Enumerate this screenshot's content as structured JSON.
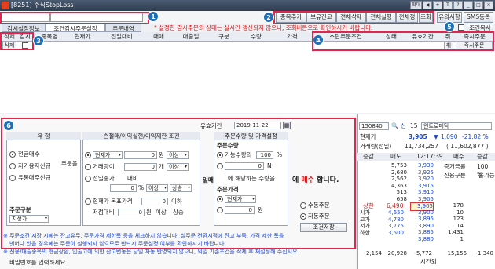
{
  "title": "[8251] 주식StopLoss",
  "window_buttons": [
    "확대",
    "◀",
    "+",
    "T",
    "?",
    "_",
    "□",
    "×"
  ],
  "toolbar": {
    "account_value": "",
    "account_name": "",
    "buttons": [
      "종목추가",
      "보유잔고",
      "전체삭제",
      "전체실행",
      "전체정지",
      "조회"
    ],
    "notice_button": "유의사항",
    "sms_button": "SMS등록",
    "condition_copy": "조건복사"
  },
  "badges": [
    "1",
    "2",
    "3",
    "4",
    "5",
    "6"
  ],
  "tabs": [
    "감시설정정보",
    "조건감시주문설정",
    "주문내역"
  ],
  "notice": "* 설정한 감시주문의 상태는 실시간 갱신되지 않으니, 조회버튼으로 확인하시기 바랍니다.",
  "grid": {
    "headers": [
      "삭제",
      "감시",
      "종목명",
      "현재가",
      "전일대비",
      "매매",
      "대출일",
      "구분",
      "수량",
      "가격",
      "스탑주문조건",
      "상태",
      "유효기간",
      "취",
      "즉시주문"
    ],
    "row": {
      "delete": "삭제",
      "cancel": "취",
      "order": "즉시주문"
    }
  },
  "form": {
    "valid_label": "유효기간",
    "valid_date": "2019-11-22",
    "section_type": "유    형",
    "types": [
      "현금매수",
      "자기융자신규",
      "유통대주신규"
    ],
    "order_type_label": "주문구분",
    "order_type": "지정가",
    "order_word": "주문을",
    "section_cond": "손절매/이익실현/이익제한 조건",
    "cond_price_label": "현재가",
    "cond_unit": "원",
    "cond_op": "이상",
    "cond_value": "0",
    "trade_qty_label": "거래량이",
    "trade_unit": "개",
    "trade_value": "0",
    "trade_op": "이상",
    "prevday_label": "전일종가",
    "prevday_op": "대비",
    "prevday_pct": "%",
    "prevday_rise": "상승",
    "prevday_value": "0",
    "target_label": "현재가 목표가격",
    "target_value": "0",
    "target_op": "이하",
    "low_label": "저점대비",
    "low_unit": "원",
    "low_op": "이상",
    "low_rise": "상승",
    "section_qty": "주문수량 및 가격설정",
    "qty_label": "주문수량",
    "qty_option": "가능수량의",
    "qty_pct": "100",
    "qty_pct_unit": "%",
    "qty_value": "0",
    "qty_n": "N",
    "qty_fit": "에 해당하는 수량을",
    "price_label": "주문가격",
    "price_option": "현재가",
    "price_value": "0",
    "price_unit": "원",
    "when_word": "일때",
    "buy_text": "에 매수 합니다.",
    "buy_word": "매수",
    "manual": "수동주문",
    "auto": "자동주문",
    "save": "조건저장"
  },
  "footnotes": [
    "※ 주문조건 저장 시에는 잔고유무, 주문가격 제한폭 등을 체크하지 않습니다. 실주문 전환시점에 잔고 부족, 가격 제한 폭을",
    "벗어나 있을 경우에는 주문이 실행되지 않으므로 반드시 주문설정 여부를 확인하시기 바랍니다.",
    "※ 신용/대출종목의 현금상환, 입출고에 의한 잔고변동은 당일 자동 반영되지 않으니, 익일 기존조건을 삭제 후 재설정해 주십시오."
  ],
  "password_placeholder": "비밀번호를 입력하세요",
  "quote": {
    "code": "150840",
    "name": "인트로메딕",
    "credit": "신",
    "fee": "15",
    "price_label": "현재가",
    "price": "3,905",
    "change_arrow": "▼",
    "change": "1,090",
    "change_pct": "-21.82 %",
    "volume_label": "거래량(전일)",
    "volume": "11,734,257",
    "prev_volume": "( 11,602,877 )",
    "headers": [
      "증감",
      "매도",
      "12:17:39",
      "매수",
      "증감"
    ],
    "ask_qty": [
      "5,753",
      "2,680",
      "2,562",
      "4,363",
      "513",
      "658"
    ],
    "ask_px": [
      "3,930",
      "3,925",
      "3,920",
      "3,915",
      "3,910",
      "3,905"
    ],
    "bid_px": [
      "3,905",
      "3,900",
      "3,895",
      "3,890",
      "3,885",
      "3,880"
    ],
    "bid_qty": [
      "178",
      "10",
      "123",
      "14",
      "1,431",
      "1"
    ],
    "deposit_label": "증거금률",
    "deposit": "100 %",
    "credit_label": "신용구분",
    "credit_val": "불가능",
    "upper_label": "상한",
    "upper": "6,490",
    "stats": [
      {
        "label": "시가",
        "value": "4,650"
      },
      {
        "label": "고가",
        "value": "4,780"
      },
      {
        "label": "저가",
        "value": "3,775"
      },
      {
        "label": "하한",
        "value": "3,500"
      }
    ],
    "bid_side_px": [
      "3,900",
      "3,895",
      "3,890",
      "3,885"
    ],
    "totals": [
      "-2,154",
      "20,928",
      "-5,772",
      "15,156",
      "-1,340"
    ],
    "time_label": "시간외"
  }
}
